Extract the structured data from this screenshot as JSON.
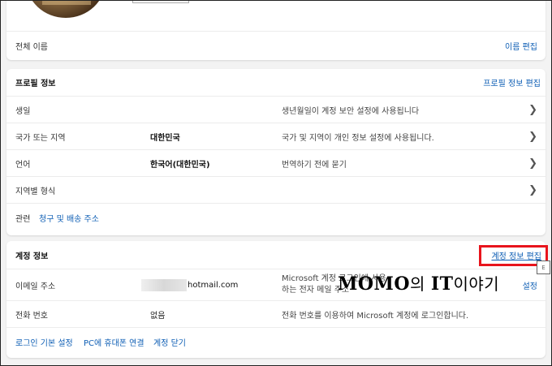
{
  "top_card": {
    "name_label": "전체 이름",
    "edit_name_link": "이름 편집"
  },
  "profile": {
    "title": "프로필 정보",
    "edit_link": "프로필 정보 편집",
    "rows": [
      {
        "label": "생일",
        "value": "",
        "desc": "생년월일이 계정 보안 설정에 사용됩니다"
      },
      {
        "label": "국가 또는 지역",
        "value": "대한민국",
        "desc": "국가 및 지역이 개인 정보 설정에 사용됩니다."
      },
      {
        "label": "언어",
        "value": "한국어(대한민국)",
        "desc": "번역하기 전에 묻기"
      },
      {
        "label": "지역별 형식",
        "value": "",
        "desc": ""
      }
    ],
    "related_label": "관련",
    "related_link": "청구 및 배송 주소"
  },
  "account": {
    "title": "계정 정보",
    "edit_link": "계정 정보 편집",
    "email_label": "이메일 주소",
    "email_value": "hotmail.com",
    "email_desc_line1": "Microsoft 계정 로그인에 사용",
    "email_desc_line2": "하는 전자 메일 주소",
    "email_settings_link": "설정",
    "phone_label": "전화 번호",
    "phone_value": "없음",
    "phone_desc": "전화 번호를 이용하여 Microsoft 계정에 로그인합니다.",
    "footer_links": [
      "로그인 기본 설정",
      "PC에 휴대폰 연결",
      "계정 닫기"
    ]
  },
  "watermark": {
    "latin1": "MOMO",
    "hangul1": "의 ",
    "latin2": "IT",
    "hangul2": "이야기"
  },
  "cursor_tip": "E"
}
